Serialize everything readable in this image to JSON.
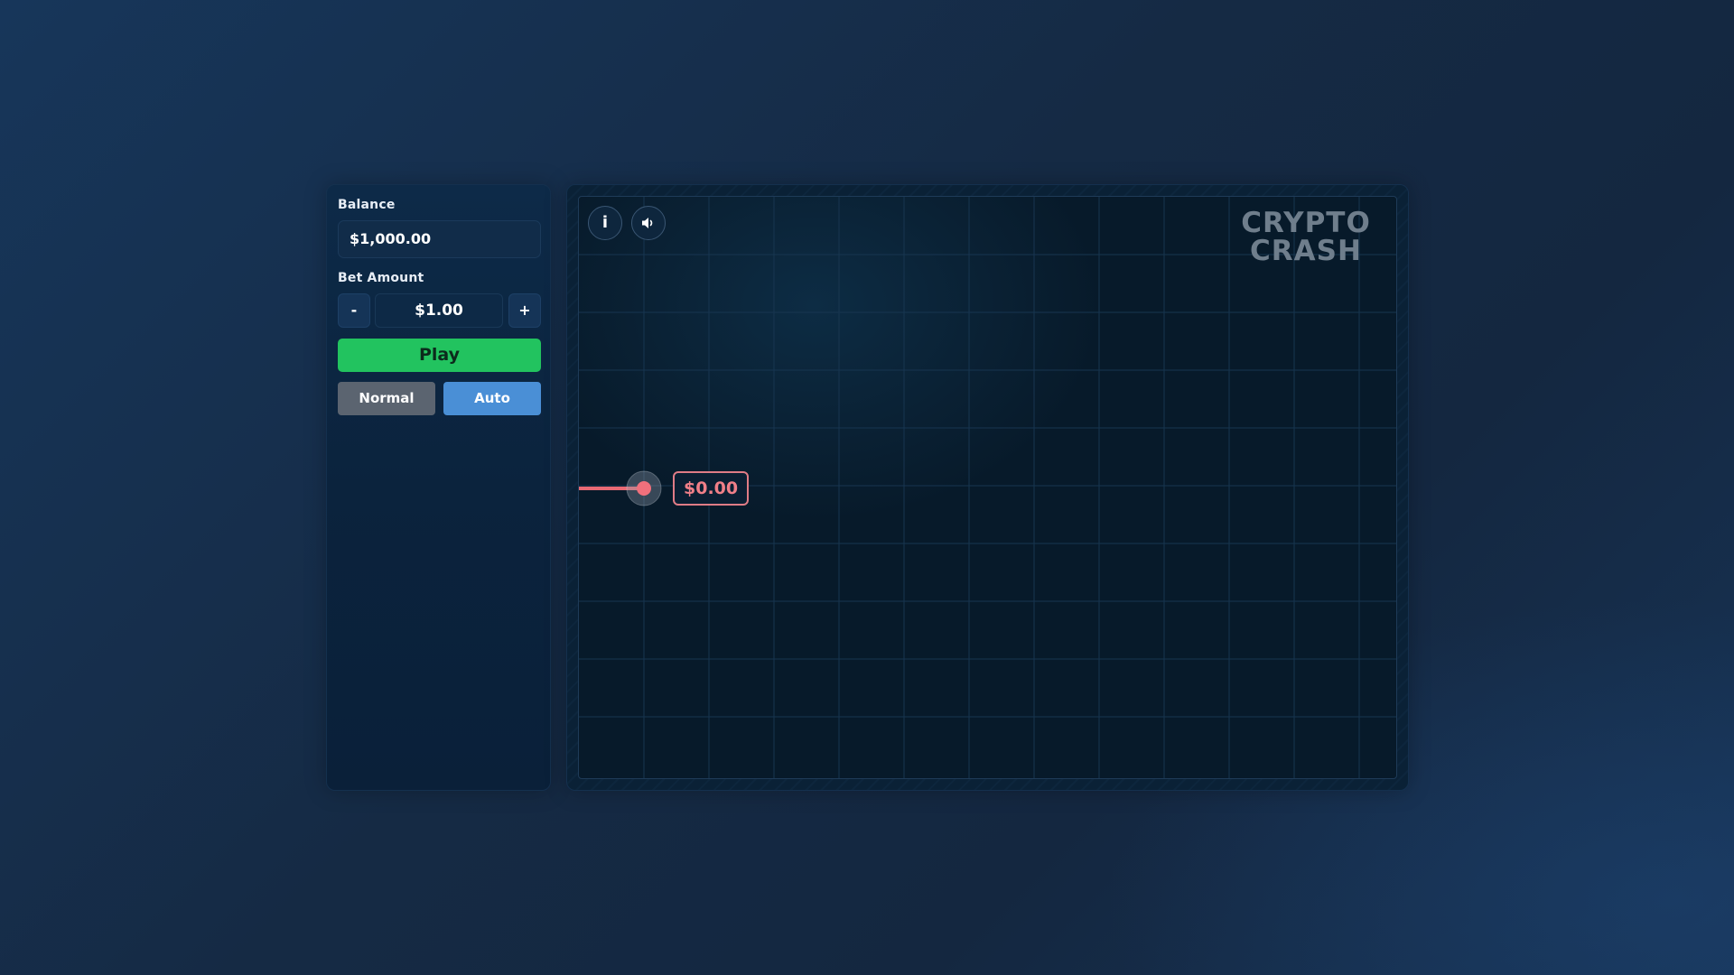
{
  "sidebar": {
    "balance_label": "Balance",
    "balance_value": "$1,000.00",
    "bet_label": "Bet Amount",
    "bet_value": "$1.00",
    "minus_label": "-",
    "plus_label": "+",
    "play_label": "Play",
    "modes": [
      {
        "label": "Normal",
        "active": true
      },
      {
        "label": "Auto",
        "active": false
      }
    ]
  },
  "game": {
    "info_label": "i",
    "info_icon": "info-icon",
    "sound_icon": "speaker-icon",
    "logo_line1": "CRYPTO",
    "logo_line2": "CRASH",
    "current_value": "$0.00",
    "colors": {
      "line": "#e86a74",
      "play": "#22c35f",
      "auto": "#4a8fd6",
      "normal": "#5b6470"
    }
  }
}
